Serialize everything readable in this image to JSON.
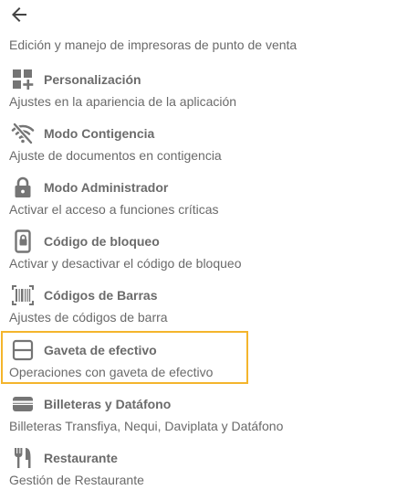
{
  "intro": "Edición y manejo de impresoras de punto de venta",
  "colors": {
    "icon": "#757575",
    "text": "#6a6a6a",
    "highlight": "#f4b52c"
  },
  "items": [
    {
      "title": "Personalización",
      "desc": "Ajustes en la apariencia de la aplicación",
      "icon": "dashboard-add-icon"
    },
    {
      "title": "Modo Contigencia",
      "desc": "Ajuste de documentos en contigencia",
      "icon": "wifi-off-icon"
    },
    {
      "title": "Modo Administrador",
      "desc": "Activar el acceso a funciones críticas",
      "icon": "lock-icon"
    },
    {
      "title": "Código de bloqueo",
      "desc": "Activar y desactivar el código de bloqueo",
      "icon": "phone-lock-icon"
    },
    {
      "title": "Códigos de Barras",
      "desc": "Ajustes de códigos de barra",
      "icon": "barcode-icon"
    },
    {
      "title": "Gaveta de efectivo",
      "desc": "Operaciones con gaveta de efectivo",
      "icon": "cash-drawer-icon",
      "selected": true
    },
    {
      "title": "Billeteras y Datáfono",
      "desc": "Billeteras Transfiya, Nequi, Daviplata y Datáfono",
      "icon": "wallet-icon"
    },
    {
      "title": "Restaurante",
      "desc": "Gestión de Restaurante",
      "icon": "restaurant-icon"
    }
  ]
}
